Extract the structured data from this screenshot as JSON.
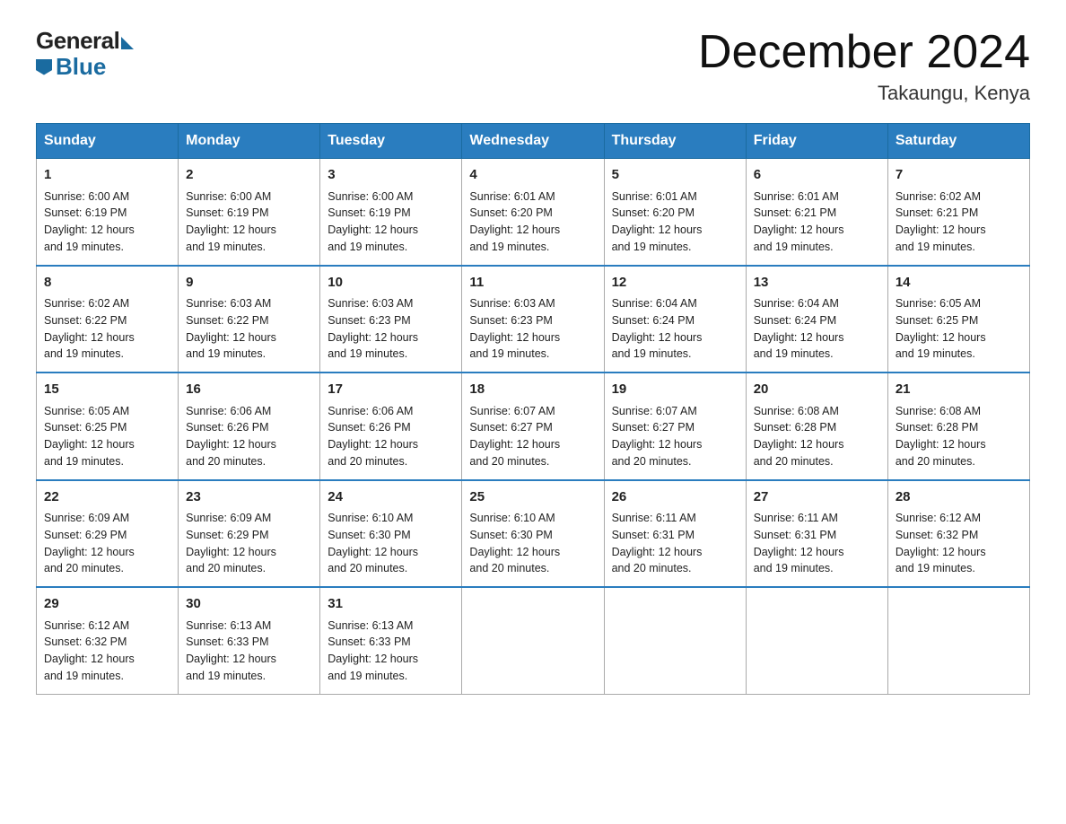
{
  "logo": {
    "general": "General",
    "blue": "Blue",
    "tagline": "Blue"
  },
  "title": {
    "month_year": "December 2024",
    "location": "Takaungu, Kenya"
  },
  "days_of_week": [
    "Sunday",
    "Monday",
    "Tuesday",
    "Wednesday",
    "Thursday",
    "Friday",
    "Saturday"
  ],
  "weeks": [
    [
      {
        "day": "1",
        "sunrise": "6:00 AM",
        "sunset": "6:19 PM",
        "daylight": "12 hours and 19 minutes."
      },
      {
        "day": "2",
        "sunrise": "6:00 AM",
        "sunset": "6:19 PM",
        "daylight": "12 hours and 19 minutes."
      },
      {
        "day": "3",
        "sunrise": "6:00 AM",
        "sunset": "6:19 PM",
        "daylight": "12 hours and 19 minutes."
      },
      {
        "day": "4",
        "sunrise": "6:01 AM",
        "sunset": "6:20 PM",
        "daylight": "12 hours and 19 minutes."
      },
      {
        "day": "5",
        "sunrise": "6:01 AM",
        "sunset": "6:20 PM",
        "daylight": "12 hours and 19 minutes."
      },
      {
        "day": "6",
        "sunrise": "6:01 AM",
        "sunset": "6:21 PM",
        "daylight": "12 hours and 19 minutes."
      },
      {
        "day": "7",
        "sunrise": "6:02 AM",
        "sunset": "6:21 PM",
        "daylight": "12 hours and 19 minutes."
      }
    ],
    [
      {
        "day": "8",
        "sunrise": "6:02 AM",
        "sunset": "6:22 PM",
        "daylight": "12 hours and 19 minutes."
      },
      {
        "day": "9",
        "sunrise": "6:03 AM",
        "sunset": "6:22 PM",
        "daylight": "12 hours and 19 minutes."
      },
      {
        "day": "10",
        "sunrise": "6:03 AM",
        "sunset": "6:23 PM",
        "daylight": "12 hours and 19 minutes."
      },
      {
        "day": "11",
        "sunrise": "6:03 AM",
        "sunset": "6:23 PM",
        "daylight": "12 hours and 19 minutes."
      },
      {
        "day": "12",
        "sunrise": "6:04 AM",
        "sunset": "6:24 PM",
        "daylight": "12 hours and 19 minutes."
      },
      {
        "day": "13",
        "sunrise": "6:04 AM",
        "sunset": "6:24 PM",
        "daylight": "12 hours and 19 minutes."
      },
      {
        "day": "14",
        "sunrise": "6:05 AM",
        "sunset": "6:25 PM",
        "daylight": "12 hours and 19 minutes."
      }
    ],
    [
      {
        "day": "15",
        "sunrise": "6:05 AM",
        "sunset": "6:25 PM",
        "daylight": "12 hours and 19 minutes."
      },
      {
        "day": "16",
        "sunrise": "6:06 AM",
        "sunset": "6:26 PM",
        "daylight": "12 hours and 20 minutes."
      },
      {
        "day": "17",
        "sunrise": "6:06 AM",
        "sunset": "6:26 PM",
        "daylight": "12 hours and 20 minutes."
      },
      {
        "day": "18",
        "sunrise": "6:07 AM",
        "sunset": "6:27 PM",
        "daylight": "12 hours and 20 minutes."
      },
      {
        "day": "19",
        "sunrise": "6:07 AM",
        "sunset": "6:27 PM",
        "daylight": "12 hours and 20 minutes."
      },
      {
        "day": "20",
        "sunrise": "6:08 AM",
        "sunset": "6:28 PM",
        "daylight": "12 hours and 20 minutes."
      },
      {
        "day": "21",
        "sunrise": "6:08 AM",
        "sunset": "6:28 PM",
        "daylight": "12 hours and 20 minutes."
      }
    ],
    [
      {
        "day": "22",
        "sunrise": "6:09 AM",
        "sunset": "6:29 PM",
        "daylight": "12 hours and 20 minutes."
      },
      {
        "day": "23",
        "sunrise": "6:09 AM",
        "sunset": "6:29 PM",
        "daylight": "12 hours and 20 minutes."
      },
      {
        "day": "24",
        "sunrise": "6:10 AM",
        "sunset": "6:30 PM",
        "daylight": "12 hours and 20 minutes."
      },
      {
        "day": "25",
        "sunrise": "6:10 AM",
        "sunset": "6:30 PM",
        "daylight": "12 hours and 20 minutes."
      },
      {
        "day": "26",
        "sunrise": "6:11 AM",
        "sunset": "6:31 PM",
        "daylight": "12 hours and 20 minutes."
      },
      {
        "day": "27",
        "sunrise": "6:11 AM",
        "sunset": "6:31 PM",
        "daylight": "12 hours and 19 minutes."
      },
      {
        "day": "28",
        "sunrise": "6:12 AM",
        "sunset": "6:32 PM",
        "daylight": "12 hours and 19 minutes."
      }
    ],
    [
      {
        "day": "29",
        "sunrise": "6:12 AM",
        "sunset": "6:32 PM",
        "daylight": "12 hours and 19 minutes."
      },
      {
        "day": "30",
        "sunrise": "6:13 AM",
        "sunset": "6:33 PM",
        "daylight": "12 hours and 19 minutes."
      },
      {
        "day": "31",
        "sunrise": "6:13 AM",
        "sunset": "6:33 PM",
        "daylight": "12 hours and 19 minutes."
      },
      null,
      null,
      null,
      null
    ]
  ]
}
